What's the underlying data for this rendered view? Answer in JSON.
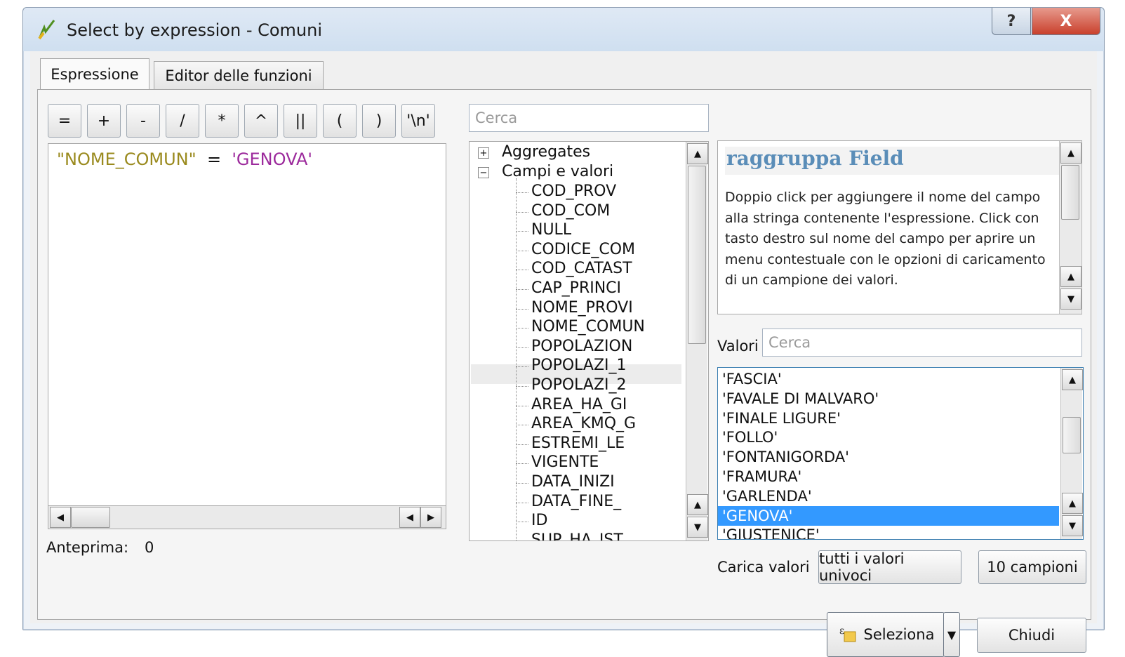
{
  "window": {
    "title": "Select by expression - Comuni",
    "help_glyph": "?",
    "close_glyph": "X"
  },
  "tabs": [
    "Espressione",
    "Editor delle funzioni"
  ],
  "operators": [
    "=",
    "+",
    "-",
    "/",
    "*",
    "^",
    "||",
    "(",
    ")",
    "'\\n'"
  ],
  "expression": {
    "field": "\"NOME_COMUN\"",
    "operator": "=",
    "value": "'GENOVA'",
    "colors": {
      "field": "#9a8a1e",
      "value": "#9c2a9c"
    }
  },
  "preview": {
    "label": "Anteprima:",
    "value": "0"
  },
  "function_search": {
    "placeholder": "Cerca"
  },
  "tree": {
    "groups": [
      {
        "label": "Aggregates",
        "expanded": false
      },
      {
        "label": "Campi e valori",
        "expanded": true
      }
    ],
    "fields": [
      "COD_PROV",
      "COD_COM",
      "NULL",
      "CODICE_COM",
      "COD_CATAST",
      "CAP_PRINCI",
      "NOME_PROVI",
      "NOME_COMUN",
      "POPOLAZION",
      "POPOLAZI_1",
      "POPOLAZI_2",
      "AREA_HA_GI",
      "AREA_KMQ_G",
      "ESTREMI_LE",
      "VIGENTE",
      "DATA_INIZI",
      "DATA_FINE_",
      "ID",
      "SUP_HA_IST"
    ],
    "selected": "NOME_COMUN"
  },
  "help": {
    "title": "raggruppa Field",
    "text": "Doppio click per aggiungere il nome del campo alla stringa contenente l'espressione. Click con tasto destro sul nome del campo per aprire un menu contestuale con le opzioni di caricamento di un campione dei valori."
  },
  "values": {
    "label": "Valori",
    "placeholder": "Cerca",
    "items": [
      "'FASCIA'",
      "'FAVALE DI MALVARO'",
      "'FINALE LIGURE'",
      "'FOLLO'",
      "'FONTANIGORDA'",
      "'FRAMURA'",
      "'GARLENDA'",
      "'GENOVA'",
      "'GIUSTENICE'"
    ],
    "selected": "'GENOVA'"
  },
  "load": {
    "label": "Carica valori",
    "all_unique": "tutti i valori univoci",
    "samples": "10 campioni"
  },
  "actions": {
    "select": "Seleziona",
    "close": "Chiudi"
  }
}
